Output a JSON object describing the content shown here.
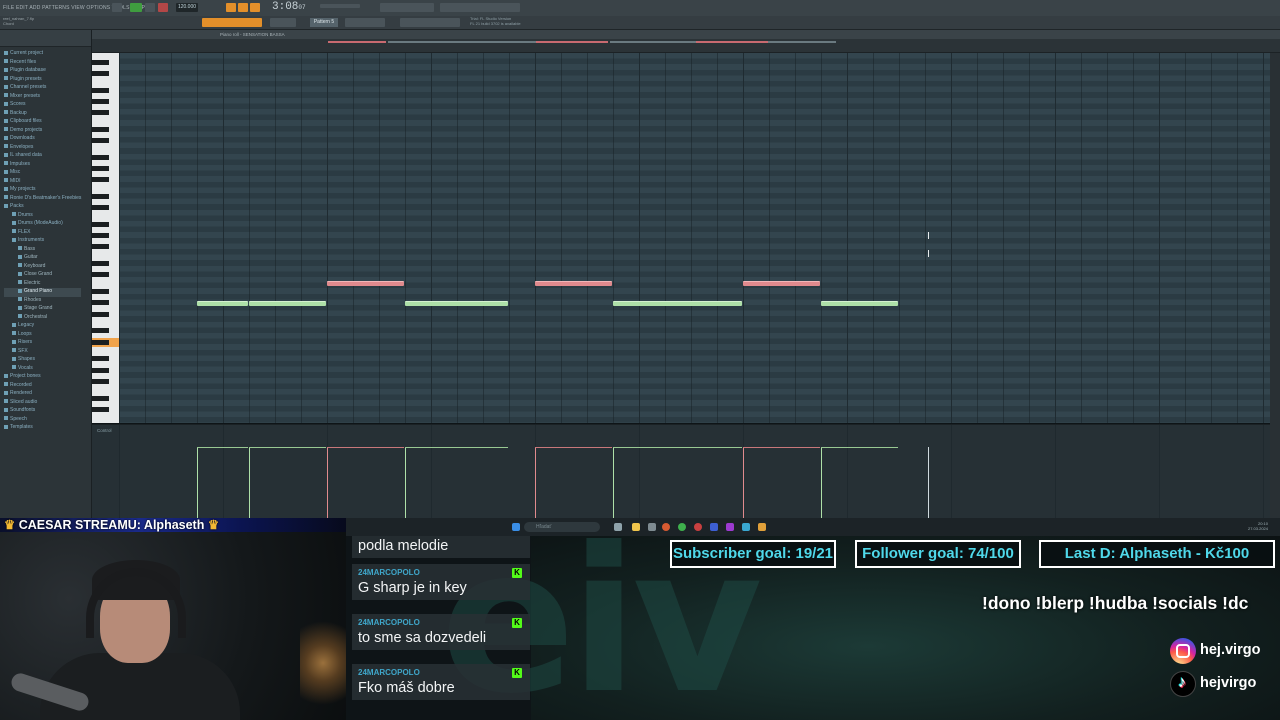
{
  "window": {
    "file_name": "reel_nahran_7.flp",
    "file_sub": "Chord",
    "menus": "FILE EDIT ADD PATTERNS VIEW OPTIONS TOOLS HELP",
    "tempo": "120.000",
    "time": "3:08",
    "time_sub": "07",
    "pattern": "Pattern 5",
    "hint_line1": "Trial: FL Studio Version",
    "hint_line2": "FL 21 build 3702 is available",
    "accent_orange": "#e38f2a",
    "accent_green": "#3f9d3f"
  },
  "browser": {
    "items": [
      {
        "label": "Current project",
        "level": 0
      },
      {
        "label": "Recent files",
        "level": 0
      },
      {
        "label": "Plugin database",
        "level": 0
      },
      {
        "label": "Plugin presets",
        "level": 0
      },
      {
        "label": "Channel presets",
        "level": 0
      },
      {
        "label": "Mixer presets",
        "level": 0
      },
      {
        "label": "Scores",
        "level": 0
      },
      {
        "label": "Backup",
        "level": 0
      },
      {
        "label": "Clipboard files",
        "level": 0
      },
      {
        "label": "Demo projects",
        "level": 0
      },
      {
        "label": "Downloads",
        "level": 0
      },
      {
        "label": "Envelopes",
        "level": 0
      },
      {
        "label": "IL shared data",
        "level": 0
      },
      {
        "label": "Impulses",
        "level": 0
      },
      {
        "label": "Misc",
        "level": 0
      },
      {
        "label": "MIDI",
        "level": 0
      },
      {
        "label": "My projects",
        "level": 0
      },
      {
        "label": "Ronie D's Beatmaker's Freebies",
        "level": 0
      },
      {
        "label": "Packs",
        "level": 0
      },
      {
        "label": "Drums",
        "level": 1
      },
      {
        "label": "Drums (ModeAudio)",
        "level": 1
      },
      {
        "label": "FLEX",
        "level": 1
      },
      {
        "label": "Instruments",
        "level": 1
      },
      {
        "label": "Bass",
        "level": 2
      },
      {
        "label": "Guitar",
        "level": 2
      },
      {
        "label": "Keyboard",
        "level": 2
      },
      {
        "label": "Close Grand",
        "level": 2
      },
      {
        "label": "Electric",
        "level": 2
      },
      {
        "label": "Grand Piano",
        "level": 2,
        "selected": true
      },
      {
        "label": "Rhodes",
        "level": 2
      },
      {
        "label": "Stage Grand",
        "level": 2
      },
      {
        "label": "Orchestral",
        "level": 2
      },
      {
        "label": "Legacy",
        "level": 1
      },
      {
        "label": "Loops",
        "level": 1
      },
      {
        "label": "Risers",
        "level": 1
      },
      {
        "label": "SFX",
        "level": 1
      },
      {
        "label": "Shapes",
        "level": 1
      },
      {
        "label": "Vocals",
        "level": 1
      },
      {
        "label": "Project bones",
        "level": 0
      },
      {
        "label": "Recorded",
        "level": 0
      },
      {
        "label": "Rendered",
        "level": 0
      },
      {
        "label": "Sliced audio",
        "level": 0
      },
      {
        "label": "Soundfonts",
        "level": 0
      },
      {
        "label": "Speech",
        "level": 0
      },
      {
        "label": "Templates",
        "level": 0
      }
    ]
  },
  "piano_roll": {
    "title": "Piano roll - SENSATION BASSA",
    "control_label": "Control",
    "notes": [
      {
        "color": "green",
        "start": 0.0,
        "length": 0.5
      },
      {
        "color": "green",
        "start": 0.5,
        "length": 0.75
      },
      {
        "color": "red",
        "start": 1.25,
        "length": 0.75
      },
      {
        "color": "green",
        "start": 2.0,
        "length": 1.0
      },
      {
        "color": "red",
        "start": 3.25,
        "length": 0.75
      },
      {
        "color": "green",
        "start": 4.0,
        "length": 1.25
      },
      {
        "color": "red",
        "start": 5.25,
        "length": 0.75
      },
      {
        "color": "green",
        "start": 6.0,
        "length": 0.75
      }
    ]
  },
  "taskbar": {
    "search_placeholder": "Hľadať",
    "clock_time": "20:10",
    "clock_date": "27.03.2024"
  },
  "stream": {
    "caesar": "CAESAR STREAMU: Alphaseth",
    "chat": [
      {
        "user": "",
        "text": "podla melodie"
      },
      {
        "user": "24MARCOPOLO",
        "text": "G sharp je in key"
      },
      {
        "user": "24MARCOPOLO",
        "text": "to sme sa dozvedeli"
      },
      {
        "user": "24MARCOPOLO",
        "text": "Fko máš dobre"
      }
    ],
    "subscriber_goal": "Subscriber goal: 19/21",
    "follower_goal": "Follower goal: 74/100",
    "last_donation": "Last D: Alphaseth - Kč100",
    "commands": "!dono !blerp !hudba !socials !dc",
    "instagram": "hej.virgo",
    "tiktok": "hejvirgo",
    "goal_color": "#4fd8ea",
    "kick_color": "#53fc18"
  }
}
